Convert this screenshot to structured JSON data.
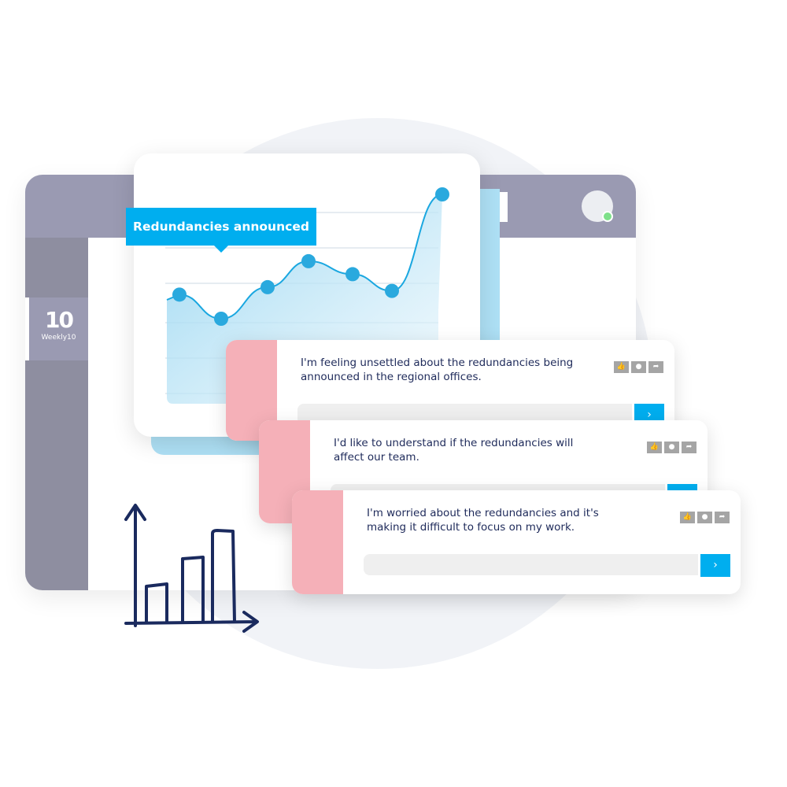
{
  "logo": {
    "number": "10",
    "name": "Weekly10"
  },
  "chart": {
    "tooltip": "Redundancies announced",
    "accent": "#00aeef",
    "points": [
      0.46,
      0.33,
      0.5,
      0.64,
      0.57,
      0.48,
      1.0
    ]
  },
  "comments": [
    {
      "text": "I'm feeling unsettled about the redundancies being announced in the regional offices.",
      "send": "›"
    },
    {
      "text": "I'd like to understand if the redundancies will affect our team.",
      "send": "›"
    },
    {
      "text": "I'm worried about the redundancies and it's making it difficult to focus on my work.",
      "send": "›"
    }
  ],
  "icons": {
    "like": "thumbs-up-icon",
    "comment": "speech-bubble-icon",
    "share": "share-arrow-icon",
    "like_glyph": "👍",
    "comment_glyph": "●",
    "share_glyph": "➦"
  },
  "colors": {
    "stripe": "#f5b0b8",
    "topbar": "#9a9ab2",
    "sidebar": "#8e8ea0",
    "text": "#1e2a5a",
    "status_online": "#7ee08a"
  }
}
